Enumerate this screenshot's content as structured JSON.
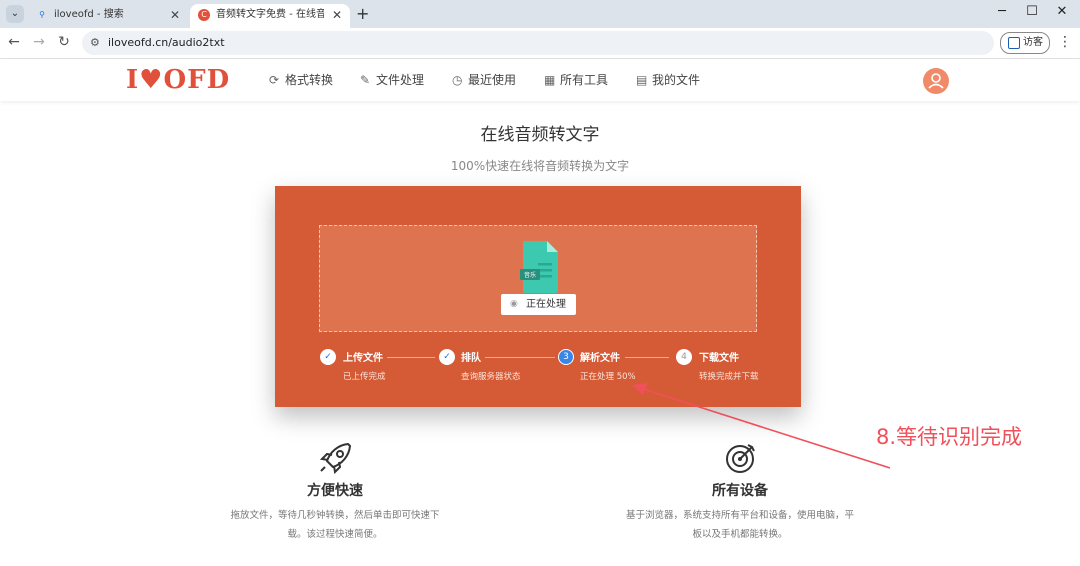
{
  "browser": {
    "tabs": [
      {
        "title": "iloveofd - 搜索",
        "active": false
      },
      {
        "title": "音频转文字免费 - 在线音频语音",
        "active": true
      }
    ],
    "url": "iloveofd.cn/audio2txt",
    "guest_label": "访客"
  },
  "site": {
    "logo": {
      "left": "I",
      "right": "OFD",
      "heart": "♥"
    },
    "nav": [
      {
        "label": "格式转换",
        "icon": "convert-icon"
      },
      {
        "label": "文件处理",
        "icon": "file-edit-icon"
      },
      {
        "label": "最近使用",
        "icon": "recent-icon"
      },
      {
        "label": "所有工具",
        "icon": "grid-icon"
      },
      {
        "label": "我的文件",
        "icon": "document-icon"
      }
    ]
  },
  "main": {
    "title": "在线音频转文字",
    "subtitle": "100%快速在线将音频转换为文字"
  },
  "card": {
    "file_badge": "音乐",
    "status_button": "正在处理",
    "steps": [
      {
        "num": "✓",
        "title": "上传文件",
        "desc": "已上传完成",
        "state": "done"
      },
      {
        "num": "✓",
        "title": "排队",
        "desc": "查询服务器状态",
        "state": "done"
      },
      {
        "num": "3",
        "title": "解析文件",
        "desc": "正在处理 50%",
        "state": "current"
      },
      {
        "num": "4",
        "title": "下载文件",
        "desc": "转换完成并下载",
        "state": "pending"
      }
    ],
    "progress_percent": 50
  },
  "features": [
    {
      "title": "方便快速",
      "desc_line1": "拖放文件，等待几秒钟转换，然后单击即可快速下",
      "desc_line2": "载。该过程快速简便。",
      "icon": "rocket-icon"
    },
    {
      "title": "所有设备",
      "desc_line1": "基于浏览器，系统支持所有平台和设备，使用电脑，平",
      "desc_line2": "板以及手机都能转换。",
      "icon": "target-icon"
    }
  ],
  "annotation": "8.等待识别完成",
  "colors": {
    "brand": "#e0503a",
    "card": "#d55a36",
    "annotation": "#f0505a",
    "step_current": "#3a86e8"
  }
}
